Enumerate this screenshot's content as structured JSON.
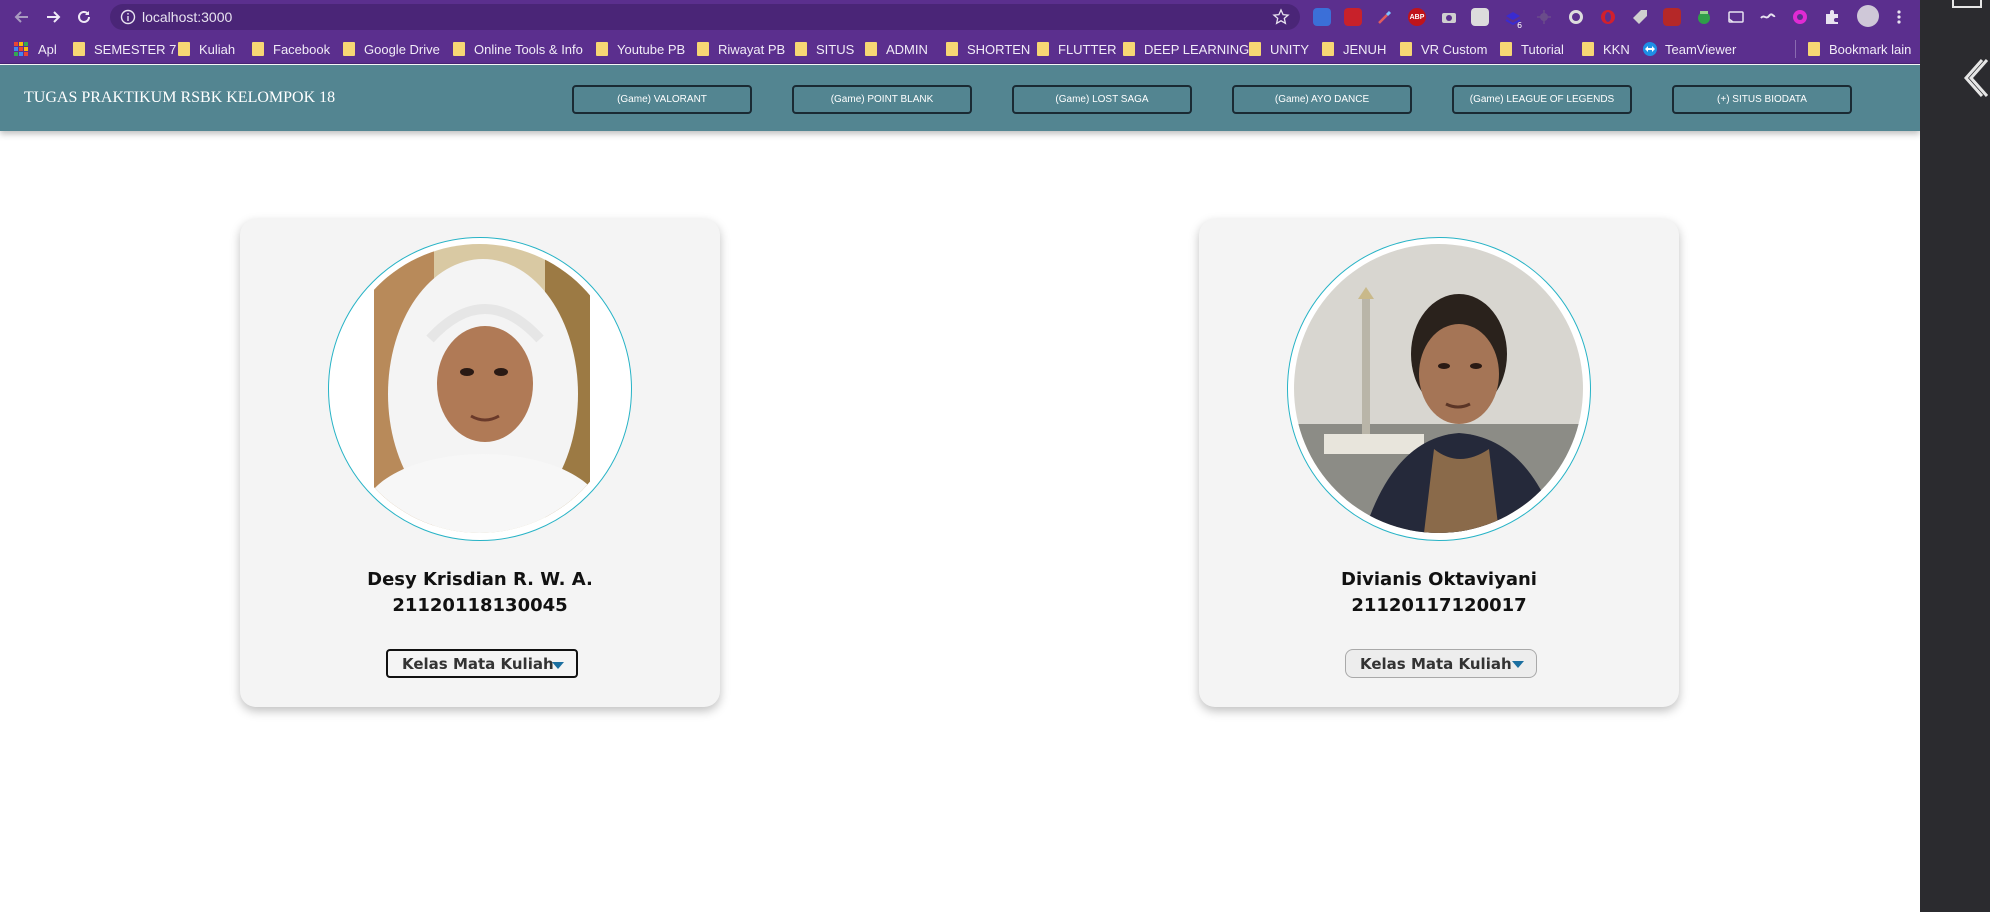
{
  "browser": {
    "url": "localhost:3000",
    "bookmarks": [
      {
        "label": "Apl",
        "kind": "apps"
      },
      {
        "label": "SEMESTER 7",
        "kind": "folder"
      },
      {
        "label": "Kuliah",
        "kind": "folder"
      },
      {
        "label": "Facebook",
        "kind": "folder"
      },
      {
        "label": "Google Drive",
        "kind": "folder"
      },
      {
        "label": "Online Tools & Info",
        "kind": "folder"
      },
      {
        "label": "Youtube PB",
        "kind": "folder"
      },
      {
        "label": "Riwayat PB",
        "kind": "folder"
      },
      {
        "label": "SITUS",
        "kind": "folder"
      },
      {
        "label": "ADMIN",
        "kind": "folder"
      },
      {
        "label": "SHORTEN",
        "kind": "folder"
      },
      {
        "label": "FLUTTER",
        "kind": "folder"
      },
      {
        "label": "DEEP LEARNING",
        "kind": "folder"
      },
      {
        "label": "UNITY",
        "kind": "folder"
      },
      {
        "label": "JENUH",
        "kind": "folder"
      },
      {
        "label": "VR Custom",
        "kind": "folder"
      },
      {
        "label": "Tutorial",
        "kind": "folder"
      },
      {
        "label": "KKN",
        "kind": "folder"
      },
      {
        "label": "TeamViewer",
        "kind": "teamviewer"
      },
      {
        "label": "Bookmark lain",
        "kind": "folder"
      }
    ],
    "extension_badge": "6",
    "colors": {
      "chrome": "#5b2f8e",
      "header": "#538591",
      "accent": "#27b3c6"
    }
  },
  "page": {
    "title": "TUGAS PRAKTIKUM RSBK KELOMPOK 18",
    "nav": [
      "(Game) VALORANT",
      "(Game) POINT BLANK",
      "(Game) LOST SAGA",
      "(Game) AYO DANCE",
      "(Game) LEAGUE OF LEGENDS",
      "(+) SITUS BIODATA"
    ],
    "cards": [
      {
        "name": "Desy Krisdian R. W. A.",
        "nim": "21120118130045",
        "dropdown": "Kelas Mata Kuliah",
        "photo": "woman-in-white-hijab"
      },
      {
        "name": "Divianis Oktaviyani",
        "nim": "21120117120017",
        "dropdown": "Kelas Mata Kuliah",
        "photo": "man-at-monument"
      }
    ]
  }
}
